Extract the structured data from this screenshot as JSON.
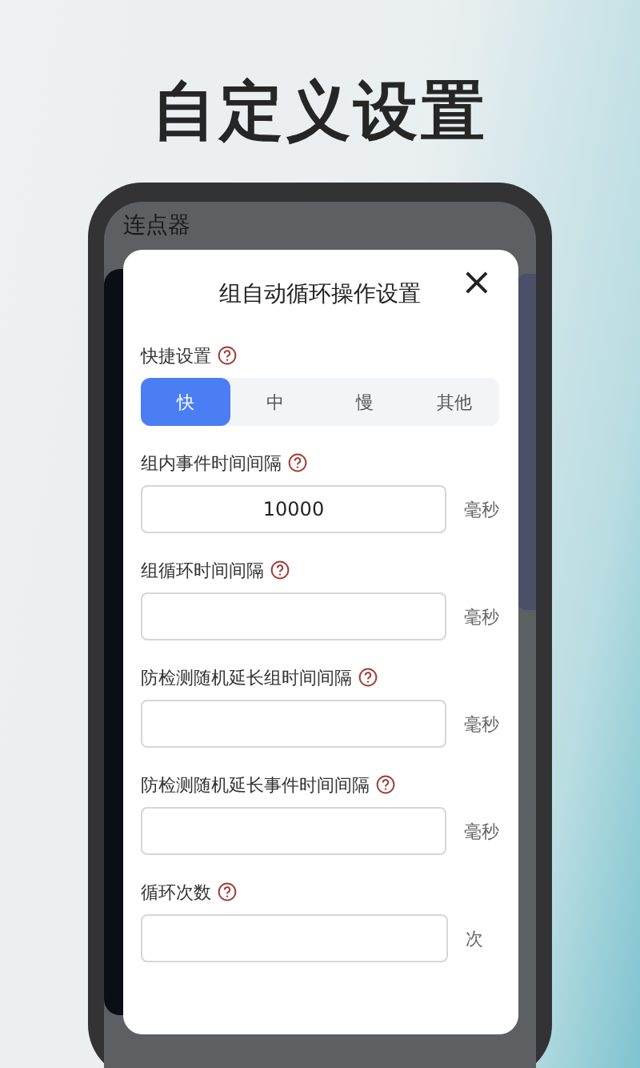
{
  "headline": "自定义设置",
  "app": {
    "title": "连点器"
  },
  "dialog": {
    "title": "组自动循环操作设置",
    "close": "×",
    "shortcut": {
      "label": "快捷设置",
      "options": [
        {
          "label": "快",
          "selected": true
        },
        {
          "label": "中",
          "selected": false
        },
        {
          "label": "慢",
          "selected": false
        },
        {
          "label": "其他",
          "selected": false
        }
      ]
    },
    "fields": [
      {
        "label": "组内事件时间间隔",
        "value": "10000",
        "unit": "毫秒"
      },
      {
        "label": "组循环时间间隔",
        "unit": "毫秒"
      },
      {
        "label": "防检测随机延长组时间间隔",
        "unit": "毫秒"
      },
      {
        "label": "防检测随机延长事件时间间隔",
        "unit": "毫秒"
      },
      {
        "label": "循环次数",
        "unit": "次"
      }
    ]
  }
}
